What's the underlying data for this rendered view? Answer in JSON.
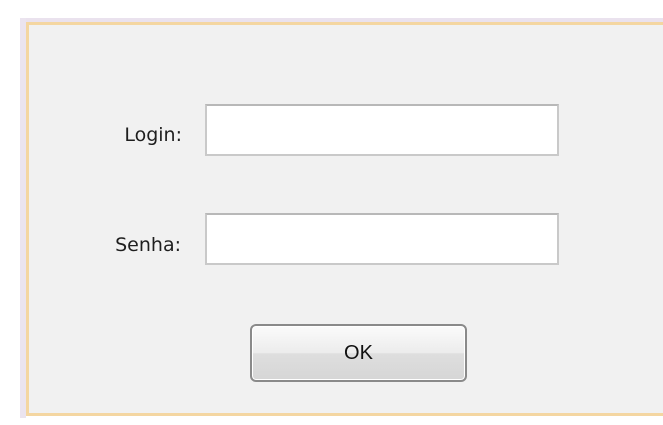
{
  "form": {
    "login_label": "Login:",
    "login_value": "",
    "senha_label": "Senha:",
    "senha_value": "",
    "ok_label": "OK"
  }
}
